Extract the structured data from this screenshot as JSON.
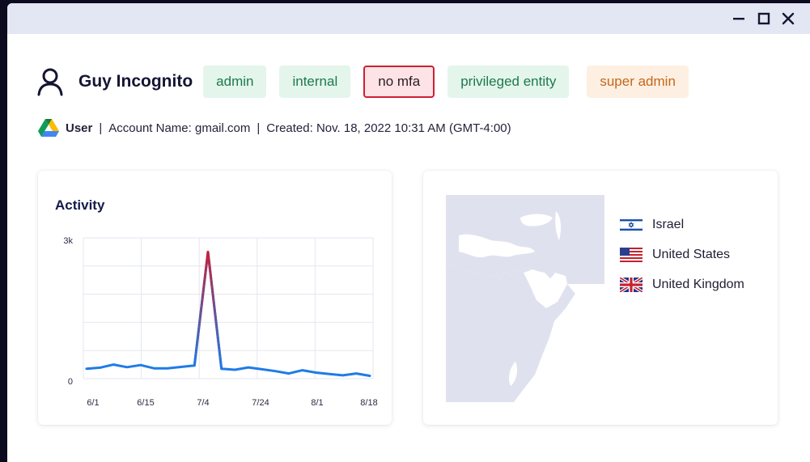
{
  "window": {
    "controls": {
      "minimize": "minimize-icon",
      "maximize": "maximize-icon",
      "close": "close-icon"
    }
  },
  "user": {
    "name": "Guy Incognito",
    "icon": "person-icon",
    "tags": [
      {
        "label": "admin",
        "style": "green"
      },
      {
        "label": "internal",
        "style": "green"
      },
      {
        "label": "no mfa",
        "style": "red"
      },
      {
        "label": "privileged entity",
        "style": "green"
      },
      {
        "label": "super admin",
        "style": "orange"
      }
    ]
  },
  "meta": {
    "source_icon": "google-drive-icon",
    "type": "User",
    "separator": "|",
    "account": "Account Name: gmail.com",
    "created": "Created: Nov. 18, 2022 10:31 AM (GMT-4:00)"
  },
  "activity": {
    "title": "Activity"
  },
  "chart_data": {
    "type": "line",
    "title": "Activity",
    "xlabel": "",
    "ylabel": "",
    "y_ticks": [
      "0",
      "3k"
    ],
    "ylim": [
      0,
      3000
    ],
    "x_ticks": [
      "6/1",
      "6/15",
      "7/4",
      "7/24",
      "8/1",
      "8/18"
    ],
    "grid": true,
    "points": [
      {
        "x": 0,
        "y": 210
      },
      {
        "x": 1,
        "y": 235
      },
      {
        "x": 2,
        "y": 300
      },
      {
        "x": 3,
        "y": 245
      },
      {
        "x": 4,
        "y": 290
      },
      {
        "x": 5,
        "y": 220
      },
      {
        "x": 6,
        "y": 220
      },
      {
        "x": 7,
        "y": 250
      },
      {
        "x": 8,
        "y": 280
      },
      {
        "x": 9,
        "y": 2700
      },
      {
        "x": 10,
        "y": 210
      },
      {
        "x": 11,
        "y": 190
      },
      {
        "x": 12,
        "y": 240
      },
      {
        "x": 13,
        "y": 200
      },
      {
        "x": 14,
        "y": 160
      },
      {
        "x": 15,
        "y": 110
      },
      {
        "x": 16,
        "y": 180
      },
      {
        "x": 17,
        "y": 130
      },
      {
        "x": 18,
        "y": 100
      },
      {
        "x": 19,
        "y": 70
      },
      {
        "x": 20,
        "y": 110
      },
      {
        "x": 21,
        "y": 60
      }
    ],
    "colors": {
      "line": "#1e7be8",
      "peak": "#c8203a"
    }
  },
  "geo": {
    "map_icon": "region-map",
    "countries": [
      {
        "name": "Israel",
        "flag": "israel-flag-icon"
      },
      {
        "name": "United States",
        "flag": "us-flag-icon"
      },
      {
        "name": "United Kingdom",
        "flag": "uk-flag-icon"
      }
    ]
  }
}
